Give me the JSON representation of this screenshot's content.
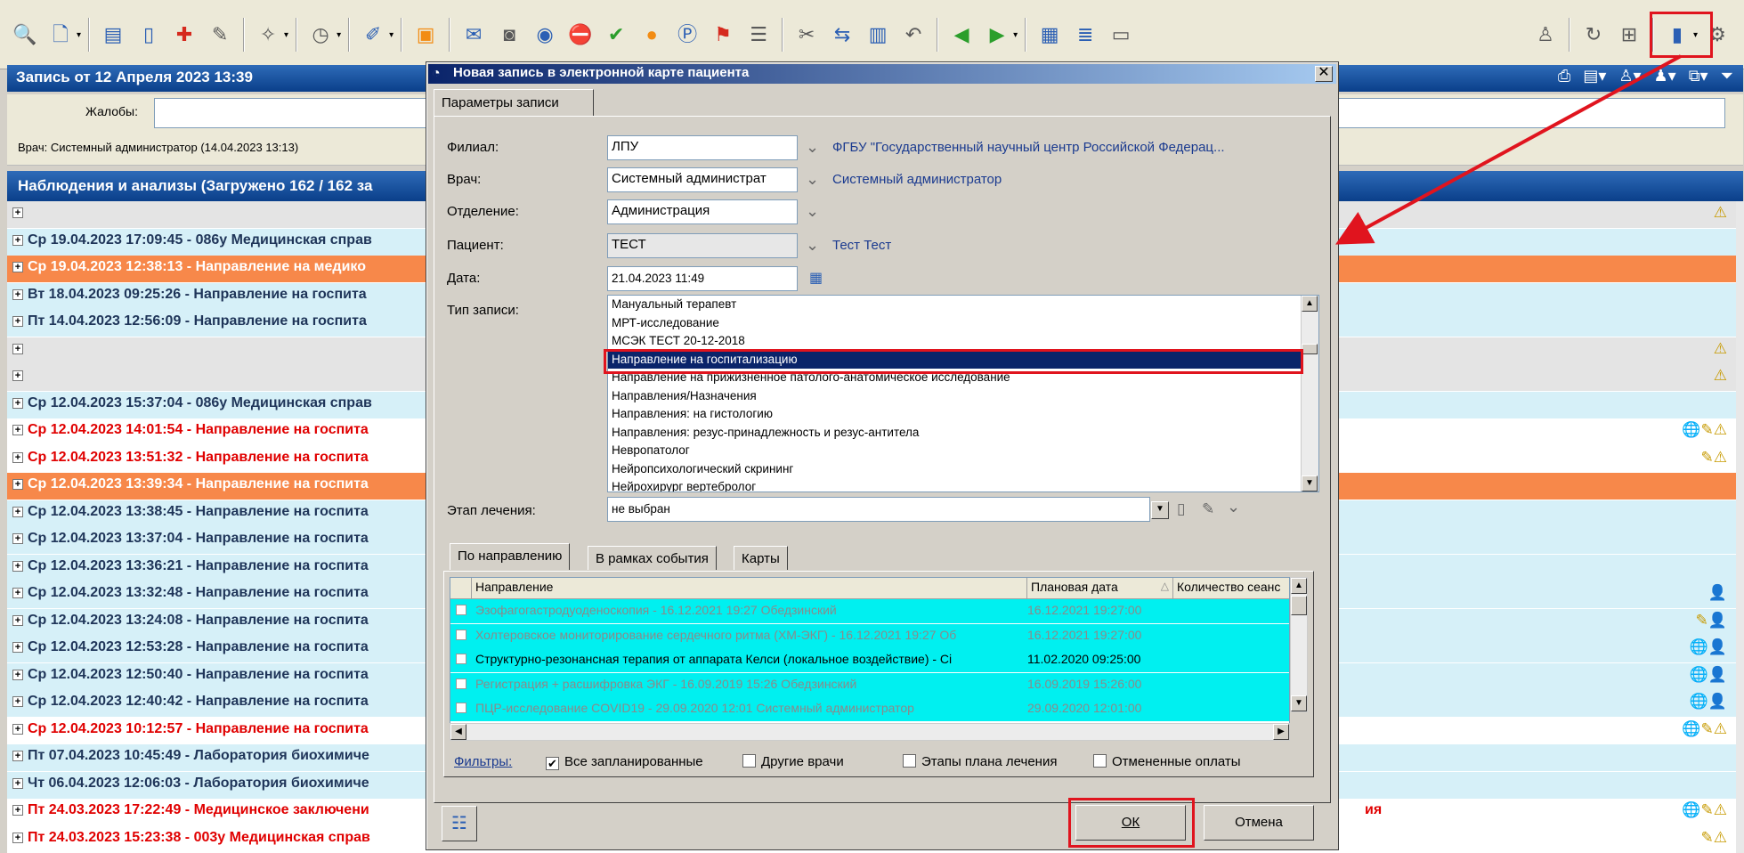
{
  "colors": {
    "annotation_red": "#e0141e",
    "title_blue": "#0a3f8a",
    "row_light": "#d6f0f8",
    "row_orange": "#f7884a",
    "row_red_text": "#e00000",
    "grid_cyan": "#00f0f0",
    "selection_navy": "#0a246a"
  },
  "toolbar": {
    "icons": [
      "user-search-icon",
      "document-icon",
      "tree-icon",
      "page-icon",
      "page-plus-icon",
      "edit-icon",
      "wand-icon",
      "clock-icon",
      "paint-icon",
      "stamp-plus-icon",
      "mail-icon",
      "camera-icon",
      "eye-icon",
      "red-no-icon",
      "green-check-icon",
      "orange-clock-icon",
      "blue-p-icon",
      "flag-icon",
      "edit-list-icon",
      "scissors-icon",
      "translate-icon",
      "clipboard-icon",
      "undo-icon",
      "arrow-left-icon",
      "arrow-right-icon",
      "calc-icon",
      "list-icon",
      "pc-icon"
    ],
    "right_icons": [
      "person-icon",
      "refresh-icon",
      "tree-view-icon",
      "new-record-icon",
      "gear-icon"
    ]
  },
  "record": {
    "title": "Запись от 12 Апреля 2023 13:39",
    "complaints_label": "Жалобы:",
    "doctor_line": "Врач: Системный администратор  (14.04.2023 13:13)"
  },
  "observations": {
    "title": "Наблюдения и анализы (Загружено 162 / 162 за",
    "rows": [
      {
        "text": "",
        "style": "gray",
        "icons": "⚠"
      },
      {
        "text": "Ср 19.04.2023 17:09:45 - 086у Медицинская справ",
        "style": "light",
        "icons": ""
      },
      {
        "text": "Ср 19.04.2023 12:38:13 - Направление на медико",
        "style": "orange",
        "icons": ""
      },
      {
        "text": "Вт 18.04.2023 09:25:26 - Направление на госпита",
        "style": "light",
        "icons": ""
      },
      {
        "text": "Пт 14.04.2023 12:56:09 - Направление на госпита",
        "style": "light",
        "icons": ""
      },
      {
        "text": "",
        "style": "gray",
        "icons": "⚠"
      },
      {
        "text": "",
        "style": "gray",
        "icons": "⚠"
      },
      {
        "text": "Ср 12.04.2023 15:37:04 - 086у Медицинская справ",
        "style": "light",
        "icons": ""
      },
      {
        "text": "Ср 12.04.2023 14:01:54 - Направление на госпита",
        "style": "white-red",
        "icons": "🌐✎⚠"
      },
      {
        "text": "Ср 12.04.2023 13:51:32 - Направление на госпита",
        "style": "white-red",
        "icons": "✎⚠"
      },
      {
        "text": "Ср 12.04.2023 13:39:34 - Направление на госпита",
        "style": "orange",
        "icons": ""
      },
      {
        "text": "Ср 12.04.2023 13:38:45 - Направление на госпита",
        "style": "light",
        "icons": ""
      },
      {
        "text": "Ср 12.04.2023 13:37:04 - Направление на госпита",
        "style": "light",
        "icons": ""
      },
      {
        "text": "Ср 12.04.2023 13:36:21 - Направление на госпита",
        "style": "light",
        "icons": ""
      },
      {
        "text": "Ср 12.04.2023 13:32:48 - Направление на госпита",
        "style": "light",
        "icons": "👤"
      },
      {
        "text": "Ср 12.04.2023 13:24:08 - Направление на госпита",
        "style": "light",
        "icons": "✎👤"
      },
      {
        "text": "Ср 12.04.2023 12:53:28 - Направление на госпита",
        "style": "light",
        "icons": "🌐👤"
      },
      {
        "text": "Ср 12.04.2023 12:50:40 - Направление на госпита",
        "style": "light",
        "icons": "🌐👤"
      },
      {
        "text": "Ср 12.04.2023 12:40:42 - Направление на госпита",
        "style": "light",
        "icons": "🌐👤"
      },
      {
        "text": "Ср 12.04.2023 10:12:57 - Направление на госпита",
        "style": "white-red",
        "icons": "🌐✎⚠"
      },
      {
        "text": "Пт 07.04.2023 10:45:49 - Лаборатория биохимиче",
        "style": "light",
        "icons": ""
      },
      {
        "text": "Чт 06.04.2023 12:06:03 - Лаборатория биохимиче",
        "style": "light",
        "icons": ""
      },
      {
        "text": "Пт 24.03.2023 17:22:49 - Медицинское заключени",
        "style": "white-red",
        "icons": "🌐✎⚠",
        "tail": "ия"
      },
      {
        "text": "Пт 24.03.2023 15:23:38 - 003у Медицинская справ",
        "style": "white-red",
        "icons": "✎⚠"
      }
    ]
  },
  "dialog": {
    "title": "Новая запись в электронной карте пациента",
    "tab": "Параметры записи",
    "fields": {
      "branch_label": "Филиал:",
      "branch_value": "ЛПУ",
      "branch_link": "ФГБУ \"Государственный научный центр Российской Федерац...",
      "doctor_label": "Врач:",
      "doctor_value": "Системный администрат",
      "doctor_link": "Системный администратор",
      "dept_label": "Отделение:",
      "dept_value": "Администрация",
      "patient_label": "Пациент:",
      "patient_value": "ТЕСТ",
      "patient_link": "Тест Тест",
      "date_label": "Дата:",
      "date_value": "21.04.2023 11:49",
      "type_label": "Тип записи:",
      "stage_label": "Этап лечения:",
      "stage_value": "не выбран"
    },
    "record_types": [
      "Мануальный терапевт",
      "МРТ-исследование",
      "МСЭК ТЕСТ 20-12-2018",
      "Направление на госпитализацию",
      "Направление на прижизненное патолого-анатомическое исследование",
      "Направления/Назначения",
      "Направления: на гистологию",
      "Направления: резус-принадлежность и резус-антитела",
      "Невропатолог",
      "Нейропсихологический скрининг",
      "Нейрохирург вертебролог"
    ],
    "selected_type_index": 3,
    "lower_tabs": [
      "По направлению",
      "В рамках события",
      "Карты"
    ],
    "grid": {
      "headers": [
        "Направление",
        "Плановая дата",
        "Количество сеанс"
      ],
      "sort_indicator": "△",
      "rows": [
        {
          "text": "Эзофагогастродуоденоскопия - 16.12.2021 19:27 Обедзинский",
          "date": "16.12.2021 19:27:00",
          "dim": true
        },
        {
          "text": "Холтеровское мониторирование сердечного ритма (ХМ-ЭКГ) - 16.12.2021 19:27 Об",
          "date": "16.12.2021 19:27:00",
          "dim": true
        },
        {
          "text": "Структурно-резонансная терапия от аппарата Келси (локальное воздействие) - Сі",
          "date": "11.02.2020 09:25:00",
          "dim": false
        },
        {
          "text": "Регистрация + расшифровка ЭКГ - 16.09.2019 15:26 Обедзинский",
          "date": "16.09.2019 15:26:00",
          "dim": true
        },
        {
          "text": "ПЦР-исследование COVID19 - 29.09.2020 12:01 Системный администратор",
          "date": "29.09.2020 12:01:00",
          "dim": true
        }
      ]
    },
    "filters": {
      "label": "Фильтры:",
      "all_planned": "Все запланированные",
      "other_doctors": "Другие врачи",
      "plan_stages": "Этапы плана лечения",
      "cancelled_payments": "Отмененные оплаты"
    },
    "ok_label": "ОК",
    "cancel_label": "Отмена"
  }
}
